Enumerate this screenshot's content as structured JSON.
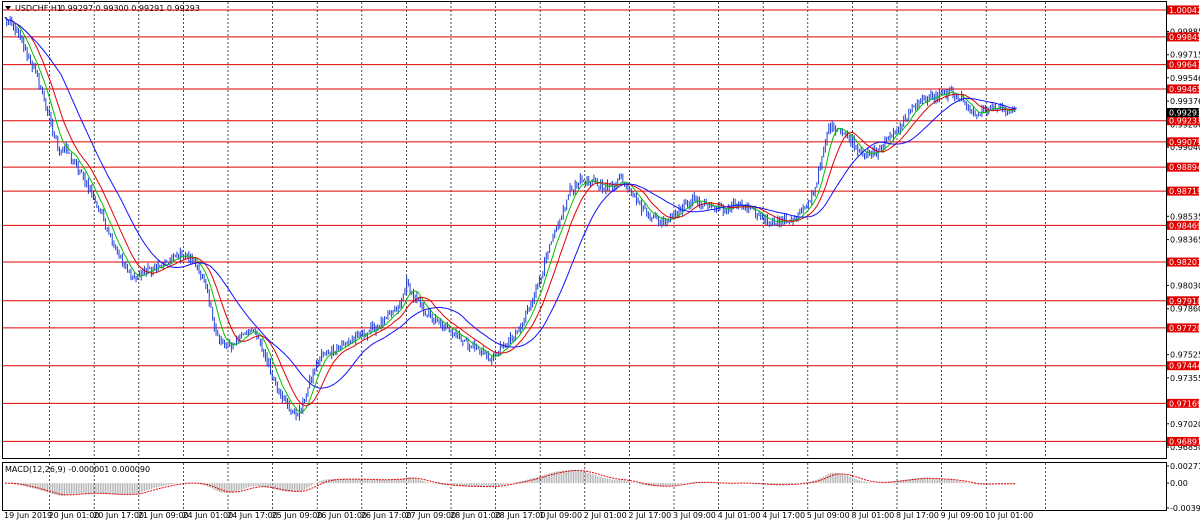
{
  "header": {
    "dropdown_icon": "triangle-down-icon",
    "symbol_label": "USDCHF,H1",
    "ohlc_text": "0.99297 0.99300 0.99291 0.99293"
  },
  "indicator": {
    "macd_label": "MACD(12,26,9) -0.000001 0.000090"
  },
  "colors": {
    "background": "#ffffff",
    "candles": "#1f3fd6",
    "fast_ma": "#00c000",
    "mid_ma": "#e00000",
    "slow_ma": "#1010ff",
    "level_line": "#e00000",
    "level_badge": "#e00000",
    "current_badge": "#000000",
    "macd_hist": "#b0b0b0",
    "macd_signal": "#e00000",
    "grid": "#000000"
  },
  "chart_data": {
    "type": "candlestick",
    "symbol": "USDCHF",
    "timeframe": "H1",
    "ylim": [
      0.9677,
      1.001
    ],
    "y_ticks": [
      "0.99885",
      "0.99715",
      "0.99546",
      "0.99376",
      "0.99206",
      "0.99040",
      "0.98535",
      "0.98365",
      "0.98030",
      "0.97860",
      "0.97525",
      "0.97355",
      "0.97020",
      "0.96850"
    ],
    "x_ticks": [
      "19 Jun 2019",
      "20 Jun 01:00",
      "20 Jun 17:00",
      "21 Jun 09:00",
      "24 Jun 01:00",
      "24 Jun 17:00",
      "25 Jun 09:00",
      "26 Jun 01:00",
      "26 Jun 17:00",
      "27 Jun 09:00",
      "28 Jun 01:00",
      "28 Jun 17:00",
      "1 Jul 09:00",
      "2 Jul 01:00",
      "2 Jul 17:00",
      "3 Jul 09:00",
      "4 Jul 01:00",
      "4 Jul 17:00",
      "5 Jul 09:00",
      "8 Jul 01:00",
      "8 Jul 17:00",
      "9 Jul 09:00",
      "10 Jul 01:00"
    ],
    "levels": [
      "1.00042",
      "0.99845",
      "0.99643",
      "0.99465",
      "0.99233",
      "0.99079",
      "0.98894",
      "0.98719",
      "0.98469",
      "0.98201",
      "0.97918",
      "0.97720",
      "0.97444",
      "0.97169",
      "0.96891"
    ],
    "current_price": "0.99293",
    "price_path": [
      [
        0,
        0.9998
      ],
      [
        6,
        0.999
      ],
      [
        12,
        0.9975
      ],
      [
        18,
        0.9958
      ],
      [
        24,
        0.9935
      ],
      [
        28,
        0.9915
      ],
      [
        32,
        0.9903
      ],
      [
        36,
        0.9902
      ],
      [
        42,
        0.989
      ],
      [
        48,
        0.9878
      ],
      [
        54,
        0.9862
      ],
      [
        60,
        0.9845
      ],
      [
        66,
        0.9828
      ],
      [
        72,
        0.9812
      ],
      [
        76,
        0.9808
      ],
      [
        80,
        0.9812
      ],
      [
        86,
        0.9815
      ],
      [
        92,
        0.9817
      ],
      [
        98,
        0.9822
      ],
      [
        104,
        0.9826
      ],
      [
        110,
        0.9822
      ],
      [
        114,
        0.9815
      ],
      [
        118,
        0.98
      ],
      [
        122,
        0.978
      ],
      [
        126,
        0.9762
      ],
      [
        130,
        0.9758
      ],
      [
        134,
        0.976
      ],
      [
        140,
        0.9768
      ],
      [
        144,
        0.9772
      ],
      [
        150,
        0.976
      ],
      [
        154,
        0.9748
      ],
      [
        158,
        0.9735
      ],
      [
        162,
        0.9725
      ],
      [
        166,
        0.9715
      ],
      [
        170,
        0.9708
      ],
      [
        174,
        0.9712
      ],
      [
        178,
        0.9728
      ],
      [
        182,
        0.9742
      ],
      [
        186,
        0.9752
      ],
      [
        190,
        0.9754
      ],
      [
        196,
        0.9758
      ],
      [
        202,
        0.9762
      ],
      [
        208,
        0.9766
      ],
      [
        214,
        0.977
      ],
      [
        220,
        0.9774
      ],
      [
        226,
        0.978
      ],
      [
        232,
        0.9788
      ],
      [
        236,
        0.9805
      ],
      [
        240,
        0.9795
      ],
      [
        246,
        0.9785
      ],
      [
        252,
        0.9778
      ],
      [
        258,
        0.9772
      ],
      [
        264,
        0.977
      ],
      [
        270,
        0.9762
      ],
      [
        276,
        0.9758
      ],
      [
        282,
        0.9752
      ],
      [
        286,
        0.975
      ],
      [
        290,
        0.9755
      ],
      [
        296,
        0.9762
      ],
      [
        302,
        0.977
      ],
      [
        308,
        0.9787
      ],
      [
        314,
        0.9808
      ],
      [
        320,
        0.983
      ],
      [
        326,
        0.985
      ],
      [
        332,
        0.9872
      ],
      [
        338,
        0.988
      ],
      [
        344,
        0.9878
      ],
      [
        350,
        0.9876
      ],
      [
        356,
        0.9875
      ],
      [
        362,
        0.9882
      ],
      [
        368,
        0.9872
      ],
      [
        374,
        0.986
      ],
      [
        380,
        0.9854
      ],
      [
        386,
        0.985
      ],
      [
        392,
        0.9855
      ],
      [
        398,
        0.986
      ],
      [
        404,
        0.9866
      ],
      [
        410,
        0.9863
      ],
      [
        416,
        0.986
      ],
      [
        422,
        0.9858
      ],
      [
        428,
        0.9862
      ],
      [
        434,
        0.986
      ],
      [
        440,
        0.9856
      ],
      [
        446,
        0.9852
      ],
      [
        452,
        0.985
      ],
      [
        458,
        0.985
      ],
      [
        464,
        0.9852
      ],
      [
        470,
        0.9858
      ],
      [
        476,
        0.9875
      ],
      [
        480,
        0.9895
      ],
      [
        484,
        0.992
      ],
      [
        490,
        0.9918
      ],
      [
        496,
        0.991
      ],
      [
        502,
        0.9902
      ],
      [
        508,
        0.9898
      ],
      [
        514,
        0.9902
      ],
      [
        520,
        0.9912
      ],
      [
        526,
        0.992
      ],
      [
        532,
        0.993
      ],
      [
        538,
        0.9938
      ],
      [
        544,
        0.994
      ],
      [
        550,
        0.9942
      ],
      [
        556,
        0.9944
      ],
      [
        562,
        0.994
      ],
      [
        566,
        0.9932
      ],
      [
        570,
        0.9928
      ],
      [
        574,
        0.993
      ],
      [
        578,
        0.9932
      ],
      [
        582,
        0.9934
      ],
      [
        586,
        0.993
      ],
      [
        590,
        0.9929
      ],
      [
        594,
        0.9929
      ]
    ],
    "macd_ylim": [
      -0.003939,
      0.002712
    ],
    "macd_ticks": [
      "0.002712",
      "0.00",
      "-0.003939"
    ]
  }
}
